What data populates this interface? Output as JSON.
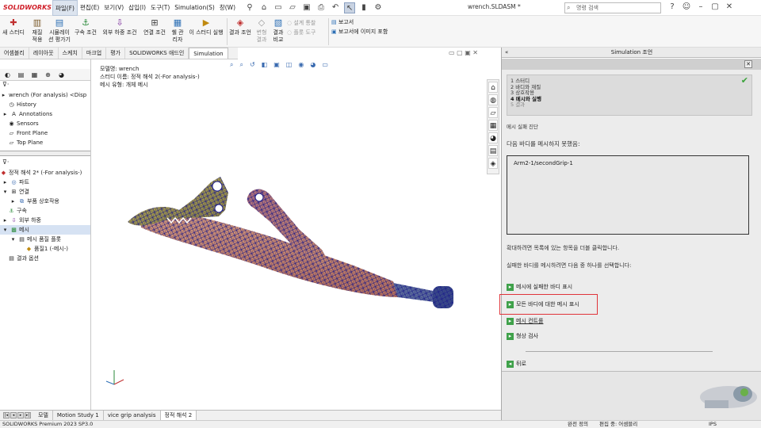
{
  "app": {
    "logo": "SOLIDWORKS",
    "doc_title": "wrench.SLDASM *"
  },
  "menu": [
    "파일(F)",
    "편집(E)",
    "보기(V)",
    "삽입(I)",
    "도구(T)",
    "Simulation(S)",
    "창(W)"
  ],
  "search": {
    "placeholder": "명령 검색"
  },
  "ribbon": {
    "groups": [
      {
        "label1": "새 스터디",
        "label2": "",
        "icon": "new-study-icon",
        "disabled": false
      },
      {
        "label1": "재질",
        "label2": "적용",
        "icon": "material-icon",
        "disabled": false
      },
      {
        "label1": "시뮬레이",
        "label2": "션 평가기",
        "icon": "sim-eval-icon",
        "disabled": false
      },
      {
        "label1": "구속 조건",
        "label2": "",
        "icon": "fixture-icon",
        "disabled": false
      },
      {
        "label1": "외부 하중 조건",
        "label2": "",
        "icon": "load-icon",
        "disabled": false
      },
      {
        "label1": "연결 조건",
        "label2": "",
        "icon": "connection-icon",
        "disabled": false
      },
      {
        "label1": "쉘 관",
        "label2": "리자",
        "icon": "shell-icon",
        "disabled": false
      },
      {
        "label1": "이 스터디 실행",
        "label2": "",
        "icon": "run-icon",
        "disabled": false
      },
      {
        "label1": "결과 조언",
        "label2": "",
        "icon": "results-advisor-icon",
        "disabled": false
      },
      {
        "label1": "변형",
        "label2": "결과",
        "icon": "deformed-icon",
        "disabled": true
      },
      {
        "label1": "결과",
        "label2": "비교",
        "icon": "compare-icon",
        "disabled": false
      }
    ],
    "small_items": [
      {
        "label": "설계 통찰",
        "disabled": true
      },
      {
        "label": "플롯 도구",
        "disabled": true
      },
      {
        "label": "보고서",
        "disabled": false
      },
      {
        "label": "보고서에 이미지 포함",
        "disabled": false
      }
    ]
  },
  "command_tabs": [
    "어셈블리",
    "레이아웃",
    "스케치",
    "마크업",
    "평가",
    "SOLIDWORKS 애드인",
    "Simulation"
  ],
  "feature_tree": {
    "root": "wrench (For analysis) <Disp",
    "items": [
      "History",
      "Annotations",
      "Sensors",
      "Front Plane",
      "Top Plane"
    ]
  },
  "sim_tree": {
    "root": "정적 해석 2* (-For analysis-)",
    "items": [
      "파트",
      "연결",
      "부품 상호작용",
      "구속",
      "외부 하중",
      "메시",
      "메시 품질 플롯",
      "품질1 (-메시-)",
      "결과 옵션"
    ]
  },
  "model_info": {
    "line1": "모델명: wrench",
    "line2": "스터디 이름: 정적 해석 2(-For analysis-)",
    "line3": "메시 유형: 개체 메시"
  },
  "right_panel": {
    "title": "Simulation 조언",
    "steps": [
      {
        "text": "1 스터디",
        "state": "done"
      },
      {
        "text": "2 바디와 재질",
        "state": "done"
      },
      {
        "text": "3 상호작용",
        "state": "done"
      },
      {
        "text": "4 메시와 실행",
        "state": "current"
      },
      {
        "text": "5 결과",
        "state": "next"
      }
    ],
    "section": "메시 실패 진단",
    "fail_msg": "다음 바디를 메시하지 못했음:",
    "failed_body": "Arm2-1/secondGrip-1",
    "hint1": "확대하려면 목록에 있는 항목을 더블 클릭합니다.",
    "hint2": "실패한 바디를 메시하려면 다음 중 하나를 선택합니다:",
    "links": [
      {
        "label": "메시에 실패한 바디 표시",
        "underline": false
      },
      {
        "label": "모든 바디에 대한 메시 표시",
        "underline": false
      },
      {
        "label": "메시 컨트롤",
        "underline": true
      },
      {
        "label": "형상 검사",
        "underline": false
      }
    ],
    "back": "뒤로"
  },
  "bottom_tabs": [
    "모델",
    "Motion Study 1",
    "vice grip analysis",
    "정적 해석 2"
  ],
  "status": {
    "left": "SOLIDWORKS Premium 2023 SP3.0",
    "r1": "완전 정의",
    "r2": "편집 중: 어셈블리",
    "r3": "IPS"
  },
  "colors": {
    "accent": "#3fa14a",
    "highlight": "#e0343a",
    "mesh_edge": "#1a1a8a"
  }
}
